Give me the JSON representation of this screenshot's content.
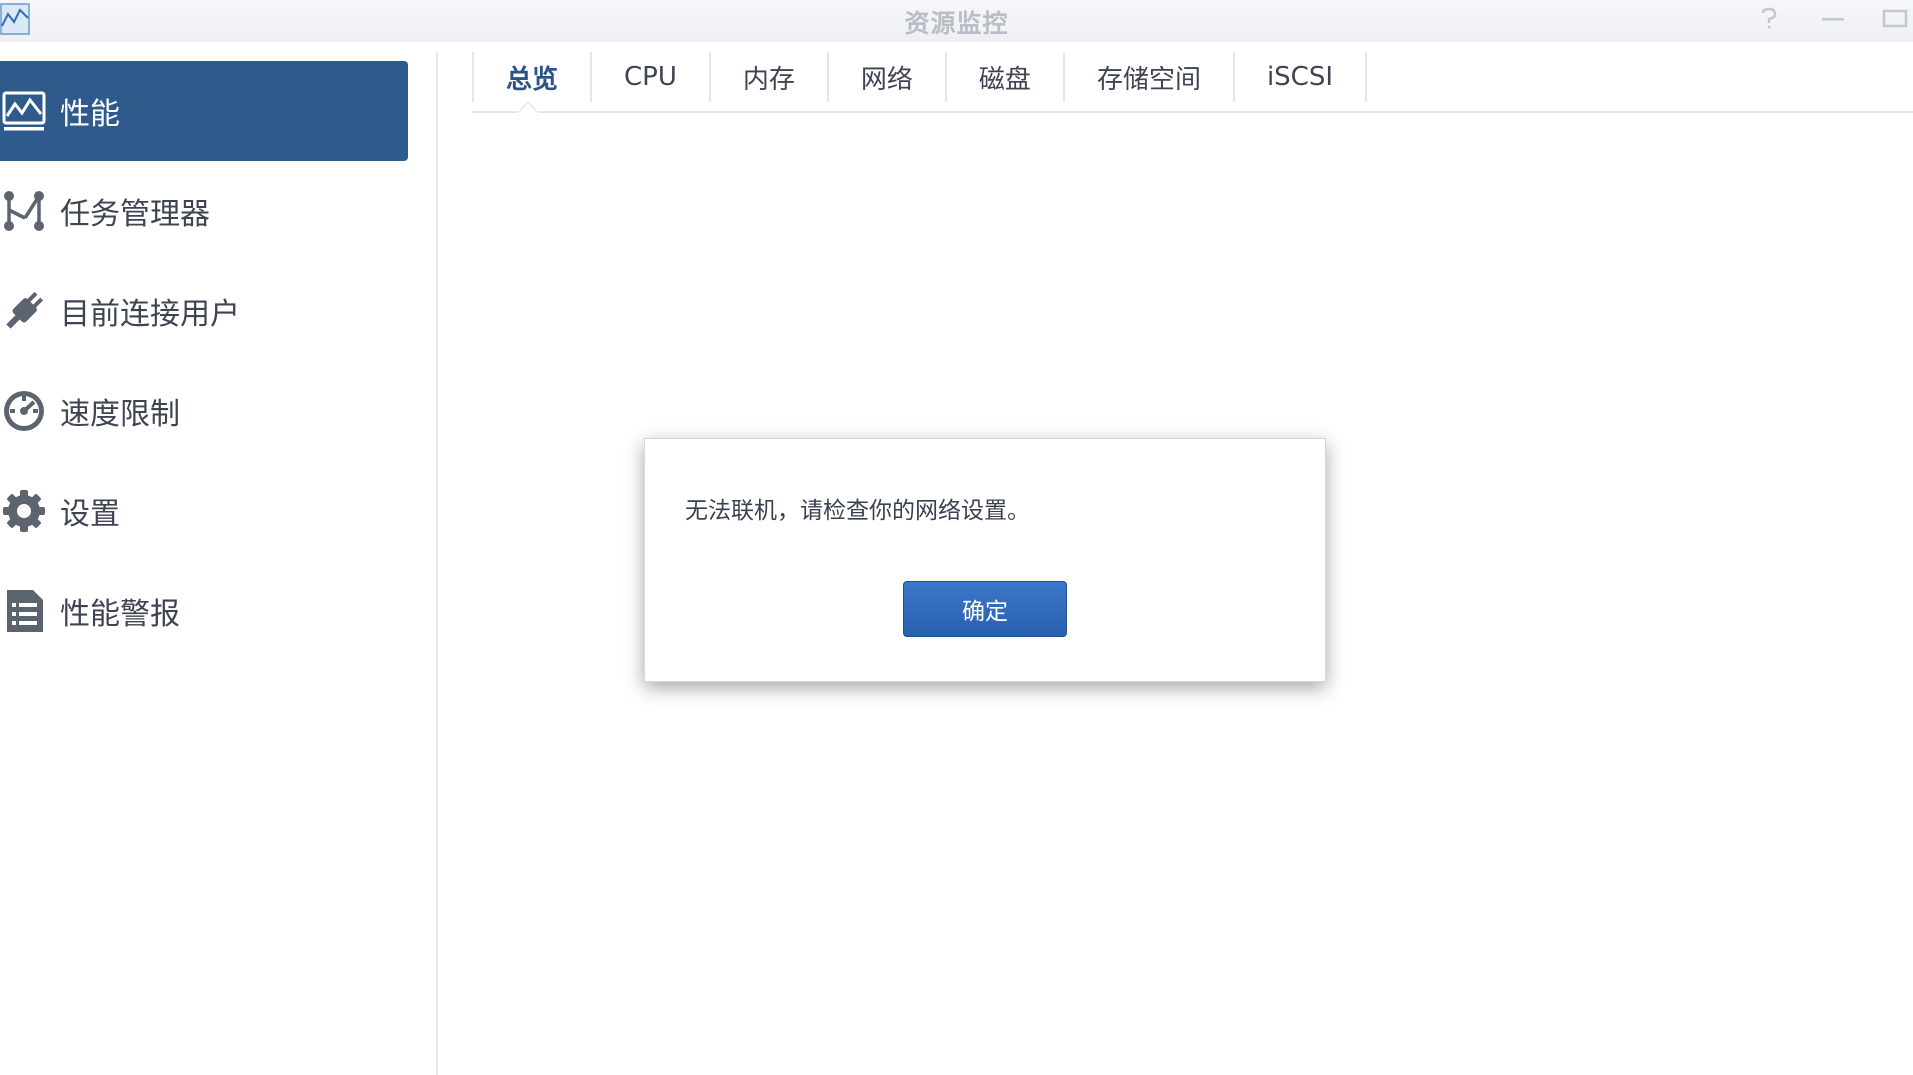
{
  "window": {
    "title": "资源监控"
  },
  "sidebar": {
    "items": [
      {
        "label": "性能",
        "icon": "performance-chart-icon",
        "active": true
      },
      {
        "label": "任务管理器",
        "icon": "task-manager-icon",
        "active": false
      },
      {
        "label": "目前连接用户",
        "icon": "plug-icon",
        "active": false
      },
      {
        "label": "速度限制",
        "icon": "speedometer-icon",
        "active": false
      },
      {
        "label": "设置",
        "icon": "gear-icon",
        "active": false
      },
      {
        "label": "性能警报",
        "icon": "list-document-icon",
        "active": false
      }
    ]
  },
  "tabs": [
    {
      "label": "总览",
      "active": true
    },
    {
      "label": "CPU",
      "active": false
    },
    {
      "label": "内存",
      "active": false
    },
    {
      "label": "网络",
      "active": false
    },
    {
      "label": "磁盘",
      "active": false
    },
    {
      "label": "存储空间",
      "active": false
    },
    {
      "label": "iSCSI",
      "active": false
    }
  ],
  "dialog": {
    "message": "无法联机，请检查你的网络设置。",
    "ok_label": "确定"
  },
  "colors": {
    "active_nav_bg": "#2f5b8c",
    "active_tab_text": "#2a5488",
    "primary_button": "#2f68b8"
  }
}
